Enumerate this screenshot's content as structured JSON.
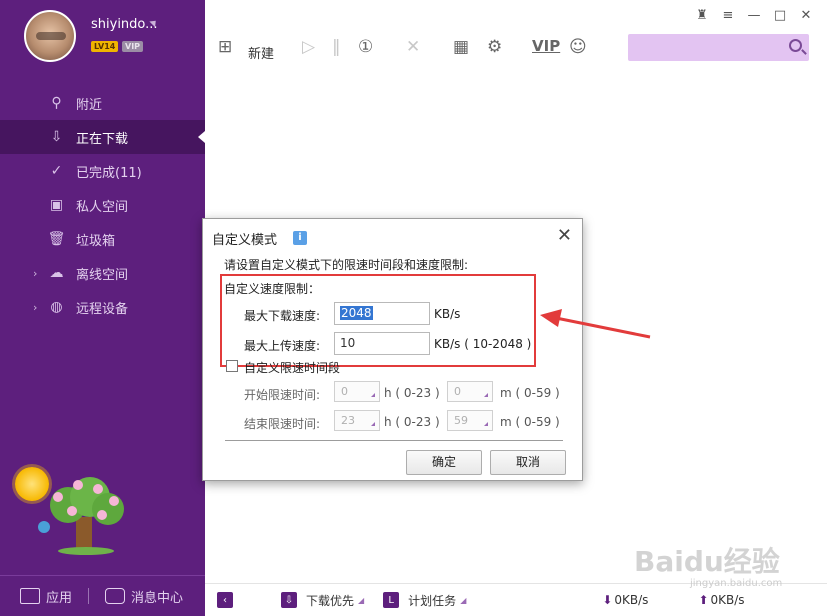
{
  "user": {
    "name": "shiyindo...",
    "level": "LV14",
    "vip": "VIP"
  },
  "sidebar": {
    "items": [
      {
        "label": "附近"
      },
      {
        "label": "正在下载"
      },
      {
        "label": "已完成(11)"
      },
      {
        "label": "私人空间"
      },
      {
        "label": "垃圾箱"
      },
      {
        "label": "离线空间"
      },
      {
        "label": "远程设备"
      }
    ],
    "bottom": {
      "apps": "应用",
      "messages": "消息中心"
    }
  },
  "toolbar": {
    "new_label": "新建",
    "vip": "VIP",
    "search_placeholder": ""
  },
  "dialog": {
    "title": "自定义模式",
    "hint": "请设置自定义模式下的限速时间段和速度限制:",
    "section": "自定义速度限制：",
    "download_label": "最大下载速度:",
    "download_value": "2048",
    "download_unit": "KB/s",
    "upload_label": "最大上传速度:",
    "upload_value": "10",
    "upload_unit": "KB/s ( 10-2048 )",
    "checkbox_label": "自定义限速时间段",
    "start_label": "开始限速时间:",
    "end_label": "结束限速时间:",
    "start_h": "0",
    "start_m": "0",
    "end_h": "23",
    "end_m": "59",
    "h_unit": "h ( 0-23 )",
    "m_unit": "m ( 0-59 )",
    "ok": "确定",
    "cancel": "取消"
  },
  "statusbar": {
    "priority": "下载优先",
    "schedule": "计划任务",
    "down_speed": "0KB/s",
    "up_speed": "0KB/s"
  },
  "watermark": {
    "main": "Baidu经验",
    "sub": "jingyan.baidu.com"
  },
  "colors": {
    "sidebar": "#5d1f7d",
    "accent": "#e23b3b",
    "search": "#e3c4f2"
  }
}
